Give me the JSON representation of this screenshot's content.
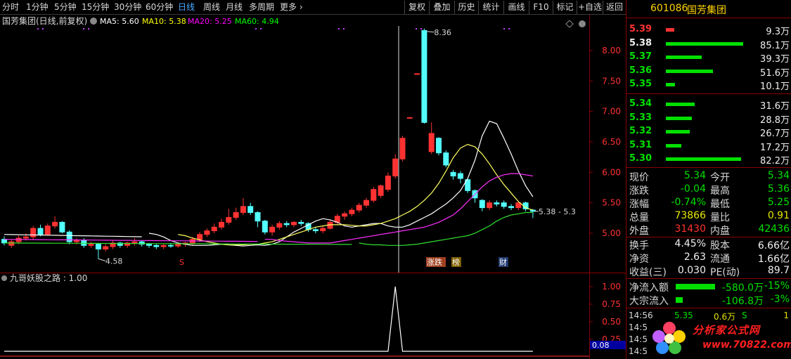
{
  "toolbar": {
    "periods": [
      "分时",
      "1分钟",
      "5分钟",
      "15分钟",
      "30分钟",
      "60分钟",
      "日线",
      "周线",
      "月线",
      "多周期",
      "更多"
    ],
    "active_period": "日线",
    "more_arrow": "›",
    "buttons": [
      "复权",
      "叠加",
      "历史",
      "统计",
      "画线",
      "F10",
      "标记",
      "+自选",
      "返回"
    ]
  },
  "main_chart": {
    "title": "国芳集团(日线,前复权)",
    "ma": [
      {
        "label": "MA5: 5.60",
        "color": "#ffffff"
      },
      {
        "label": "MA10: 5.38",
        "color": "#ffff00"
      },
      {
        "label": "MA20: 5.25",
        "color": "#ff00ff"
      },
      {
        "label": "MA60: 4.94",
        "color": "#00ff00"
      }
    ],
    "price_ticks": [
      "8.00",
      "7.50",
      "7.00",
      "6.50",
      "6.00",
      "5.50",
      "5.00"
    ],
    "high_label": "8.36",
    "low_label": "4.58",
    "last_label": "5.38 - 5.3",
    "markers": [
      {
        "text": "S",
        "color": "#ff3232"
      },
      {
        "text": "涨跌",
        "color": "#ffffff",
        "bg": "#a04020"
      },
      {
        "text": "榜",
        "color": "#ffffff",
        "bg": "#806000"
      },
      {
        "text": "财",
        "color": "#ffffff",
        "bg": "#203a70"
      }
    ]
  },
  "indicator": {
    "title": "九哥妖股之路 : 1.00",
    "ticks": [
      "1.00",
      "0.75",
      "0.50",
      "0.25"
    ],
    "current": "0.08"
  },
  "panel": {
    "code": "601086",
    "name": "国芳集团",
    "asks": [
      {
        "price": "5.39",
        "vol": "9.3万",
        "color": "#ff3232",
        "bar": 0.11,
        "bar_color": "#ff3232"
      },
      {
        "price": "5.38",
        "vol": "85.1万",
        "color": "#f0f0f0",
        "bar": 1.0,
        "bar_color": "#00e000"
      },
      {
        "price": "5.37",
        "vol": "39.3万",
        "color": "#00e000",
        "bar": 0.46,
        "bar_color": "#00e000"
      },
      {
        "price": "5.36",
        "vol": "51.6万",
        "color": "#00e000",
        "bar": 0.61,
        "bar_color": "#00e000"
      },
      {
        "price": "5.35",
        "vol": "10.1万",
        "color": "#00e000",
        "bar": 0.12,
        "bar_color": "#00e000"
      }
    ],
    "bids": [
      {
        "price": "5.34",
        "vol": "31.6万",
        "color": "#00e000",
        "bar": 0.37,
        "bar_color": "#00e000"
      },
      {
        "price": "5.33",
        "vol": "28.8万",
        "color": "#00e000",
        "bar": 0.34,
        "bar_color": "#00e000"
      },
      {
        "price": "5.32",
        "vol": "26.7万",
        "color": "#00e000",
        "bar": 0.31,
        "bar_color": "#00e000"
      },
      {
        "price": "5.31",
        "vol": "17.2万",
        "color": "#00e000",
        "bar": 0.2,
        "bar_color": "#00e000"
      },
      {
        "price": "5.30",
        "vol": "82.2万",
        "color": "#00e000",
        "bar": 0.97,
        "bar_color": "#00e000"
      }
    ],
    "quote": [
      {
        "l1": "现价",
        "v1": "5.34",
        "c1": "#00e000",
        "l2": "今开",
        "v2": "5.34",
        "c2": "#00e000"
      },
      {
        "l1": "涨跌",
        "v1": "-0.04",
        "c1": "#00e000",
        "l2": "最高",
        "v2": "5.36",
        "c2": "#00e000"
      },
      {
        "l1": "涨幅",
        "v1": "-0.74%",
        "c1": "#00e000",
        "l2": "最低",
        "v2": "5.25",
        "c2": "#00e000"
      },
      {
        "l1": "总量",
        "v1": "73866",
        "c1": "#e8e800",
        "l2": "量比",
        "v2": "0.91",
        "c2": "#e8e800"
      },
      {
        "l1": "外盘",
        "v1": "31430",
        "c1": "#ff3232",
        "l2": "内盘",
        "v2": "42436",
        "c2": "#00e000"
      }
    ],
    "quote2": [
      {
        "l1": "换手",
        "v1": "4.45%",
        "c1": "#f0f0f0",
        "l2": "股本",
        "v2": "6.66亿",
        "c2": "#f0f0f0"
      },
      {
        "l1": "净资",
        "v1": "2.63",
        "c1": "#f0f0f0",
        "l2": "流通",
        "v2": "1.66亿",
        "c2": "#f0f0f0"
      },
      {
        "l1": "收益(三)",
        "v1": "0.030",
        "c1": "#f0f0f0",
        "l2": "PE(动)",
        "v2": "89.7",
        "c2": "#f0f0f0"
      }
    ],
    "flows": [
      {
        "label": "净流入额",
        "value": "-580.0万",
        "pct": "-15%",
        "bar": 1.0
      },
      {
        "label": "大宗流入",
        "value": "-106.8万",
        "pct": "-3%",
        "bar": 0.18
      }
    ],
    "ticks": [
      {
        "time": "14:56",
        "price": "5.35",
        "vol": "0.6万",
        "bs": "S",
        "n": "1"
      },
      {
        "time": "14:5",
        "price": "",
        "vol": "",
        "bs": "",
        "n": ""
      },
      {
        "time": "14:5",
        "price": "",
        "vol": "",
        "bs": "",
        "n": ""
      },
      {
        "time": "14:5",
        "price": "",
        "vol": "",
        "bs": "",
        "n": ""
      }
    ],
    "watermark": {
      "name": "分析家公式网",
      "url": "www.70822.com"
    }
  },
  "chart_data": {
    "type": "candlestick",
    "title": "国芳集团(日线,前复权)",
    "ylim": [
      4.45,
      8.6
    ],
    "series": [
      {
        "open": 4.9,
        "close": 4.84,
        "high": 4.95,
        "low": 4.8
      },
      {
        "open": 4.8,
        "close": 4.86,
        "high": 4.9,
        "low": 4.76
      },
      {
        "open": 4.86,
        "close": 4.92,
        "high": 4.96,
        "low": 4.82
      },
      {
        "open": 4.92,
        "close": 4.94,
        "high": 5.0,
        "low": 4.88
      },
      {
        "open": 4.94,
        "close": 5.08,
        "high": 5.12,
        "low": 4.9
      },
      {
        "open": 5.08,
        "close": 4.98,
        "high": 5.14,
        "low": 4.95
      },
      {
        "open": 4.98,
        "close": 5.12,
        "high": 5.16,
        "low": 4.96
      },
      {
        "open": 5.12,
        "close": 5.18,
        "high": 5.28,
        "low": 5.08
      },
      {
        "open": 5.18,
        "close": 5.02,
        "high": 5.2,
        "low": 5.0
      },
      {
        "open": 5.02,
        "close": 4.86,
        "high": 5.05,
        "low": 4.82
      },
      {
        "open": 4.86,
        "close": 4.88,
        "high": 4.92,
        "low": 4.82
      },
      {
        "open": 4.88,
        "close": 4.8,
        "high": 4.92,
        "low": 4.76
      },
      {
        "open": 4.8,
        "close": 4.82,
        "high": 4.86,
        "low": 4.76
      },
      {
        "open": 4.82,
        "close": 4.74,
        "high": 4.84,
        "low": 4.58
      },
      {
        "open": 4.74,
        "close": 4.78,
        "high": 4.82,
        "low": 4.7
      },
      {
        "open": 4.78,
        "close": 4.84,
        "high": 4.88,
        "low": 4.74
      },
      {
        "open": 4.84,
        "close": 4.8,
        "high": 4.86,
        "low": 4.76
      },
      {
        "open": 4.8,
        "close": 4.84,
        "high": 4.86,
        "low": 4.76
      },
      {
        "open": 4.84,
        "close": 4.86,
        "high": 4.92,
        "low": 4.8
      },
      {
        "open": 4.86,
        "close": 4.82,
        "high": 4.88,
        "low": 4.78
      },
      {
        "open": 4.82,
        "close": 4.8,
        "high": 4.84,
        "low": 4.76
      },
      {
        "open": 4.8,
        "close": 4.78,
        "high": 4.82,
        "low": 4.74
      },
      {
        "open": 4.78,
        "close": 4.8,
        "high": 4.82,
        "low": 4.74
      },
      {
        "open": 4.8,
        "close": 4.79,
        "high": 4.84,
        "low": 4.76
      },
      {
        "open": 4.79,
        "close": 4.82,
        "high": 4.84,
        "low": 4.76
      },
      {
        "open": 4.82,
        "close": 4.84,
        "high": 4.86,
        "low": 4.78
      },
      {
        "open": 4.84,
        "close": 4.9,
        "high": 4.94,
        "low": 4.8
      },
      {
        "open": 4.9,
        "close": 4.98,
        "high": 5.02,
        "low": 4.86
      },
      {
        "open": 4.98,
        "close": 5.04,
        "high": 5.08,
        "low": 4.94
      },
      {
        "open": 5.04,
        "close": 5.1,
        "high": 5.16,
        "low": 5.0
      },
      {
        "open": 5.1,
        "close": 5.18,
        "high": 5.24,
        "low": 5.06
      },
      {
        "open": 5.18,
        "close": 5.26,
        "high": 5.4,
        "low": 5.14
      },
      {
        "open": 5.26,
        "close": 5.34,
        "high": 5.42,
        "low": 5.22
      },
      {
        "open": 5.34,
        "close": 5.44,
        "high": 5.58,
        "low": 5.3
      },
      {
        "open": 5.44,
        "close": 5.34,
        "high": 5.5,
        "low": 5.3
      },
      {
        "open": 5.34,
        "close": 5.2,
        "high": 5.36,
        "low": 5.1
      },
      {
        "open": 5.2,
        "close": 5.02,
        "high": 5.22,
        "low": 4.98
      },
      {
        "open": 5.02,
        "close": 5.1,
        "high": 5.14,
        "low": 4.96
      },
      {
        "open": 5.1,
        "close": 5.16,
        "high": 5.2,
        "low": 5.06
      },
      {
        "open": 5.16,
        "close": 5.14,
        "high": 5.2,
        "low": 5.1
      },
      {
        "open": 5.14,
        "close": 5.18,
        "high": 5.2,
        "low": 5.1
      },
      {
        "open": 5.18,
        "close": 5.16,
        "high": 5.22,
        "low": 5.12
      },
      {
        "open": 5.16,
        "close": 5.06,
        "high": 5.18,
        "low": 5.02
      },
      {
        "open": 5.06,
        "close": 5.04,
        "high": 5.1,
        "low": 5.0
      },
      {
        "open": 5.04,
        "close": 5.08,
        "high": 5.12,
        "low": 5.0
      },
      {
        "open": 5.08,
        "close": 5.18,
        "high": 5.22,
        "low": 5.06
      },
      {
        "open": 5.18,
        "close": 5.28,
        "high": 5.32,
        "low": 5.14
      },
      {
        "open": 5.28,
        "close": 5.32,
        "high": 5.36,
        "low": 5.22
      },
      {
        "open": 5.32,
        "close": 5.38,
        "high": 5.42,
        "low": 5.28
      },
      {
        "open": 5.38,
        "close": 5.46,
        "high": 5.5,
        "low": 5.34
      },
      {
        "open": 5.46,
        "close": 5.54,
        "high": 5.58,
        "low": 5.42
      },
      {
        "open": 5.54,
        "close": 5.72,
        "high": 5.76,
        "low": 5.5
      },
      {
        "open": 5.62,
        "close": 5.78,
        "high": 5.8,
        "low": 5.58
      },
      {
        "open": 5.72,
        "close": 5.94,
        "high": 6.0,
        "low": 5.68
      },
      {
        "open": 5.94,
        "close": 6.22,
        "high": 6.3,
        "low": 5.9
      },
      {
        "open": 6.22,
        "close": 6.56,
        "high": 6.6,
        "low": 6.18
      },
      {
        "open": 6.9,
        "close": 6.9,
        "high": 6.91,
        "low": 6.89
      },
      {
        "open": 7.62,
        "close": 7.62,
        "high": 7.63,
        "low": 7.61
      },
      {
        "open": 8.33,
        "close": 6.82,
        "high": 8.36,
        "low": 6.8
      },
      {
        "open": 6.34,
        "close": 6.64,
        "high": 6.82,
        "low": 6.3
      },
      {
        "open": 6.56,
        "close": 6.32,
        "high": 6.58,
        "low": 6.28
      },
      {
        "open": 6.32,
        "close": 6.12,
        "high": 6.36,
        "low": 6.08
      },
      {
        "open": 6.0,
        "close": 5.94,
        "high": 6.04,
        "low": 5.88
      },
      {
        "open": 5.98,
        "close": 5.9,
        "high": 6.02,
        "low": 5.82
      },
      {
        "open": 5.88,
        "close": 5.7,
        "high": 5.9,
        "low": 5.66
      },
      {
        "open": 5.7,
        "close": 5.58,
        "high": 5.72,
        "low": 5.5
      },
      {
        "open": 5.54,
        "close": 5.42,
        "high": 5.56,
        "low": 5.36
      },
      {
        "open": 5.42,
        "close": 5.5,
        "high": 5.54,
        "low": 5.38
      },
      {
        "open": 5.5,
        "close": 5.48,
        "high": 5.54,
        "low": 5.44
      },
      {
        "open": 5.5,
        "close": 5.44,
        "high": 5.54,
        "low": 5.4
      },
      {
        "open": 5.44,
        "close": 5.42,
        "high": 5.48,
        "low": 5.38
      },
      {
        "open": 5.42,
        "close": 5.5,
        "high": 5.52,
        "low": 5.38
      },
      {
        "open": 5.5,
        "close": 5.4,
        "high": 5.52,
        "low": 5.36
      },
      {
        "open": 5.38,
        "close": 5.36,
        "high": 5.4,
        "low": 5.25
      }
    ],
    "ma5": [
      5.0,
      4.98,
      4.94,
      4.88,
      4.84,
      4.82,
      4.8,
      4.8,
      4.8,
      4.81,
      4.82,
      4.81,
      4.8,
      4.79,
      4.8,
      4.81,
      4.8,
      4.82,
      4.86,
      4.94,
      5.02,
      5.08,
      5.14,
      5.2,
      5.24,
      5.22,
      5.18,
      5.12,
      5.1,
      5.12,
      5.14,
      5.16,
      5.16,
      5.12,
      5.1,
      5.1,
      5.14,
      5.2,
      5.26,
      5.32,
      5.4,
      5.48,
      5.58,
      5.7,
      5.9,
      6.2,
      6.6,
      6.84,
      6.8,
      6.56,
      6.3,
      6.02,
      5.78,
      5.6
    ],
    "ma10": [
      4.98,
      4.96,
      4.92,
      4.89,
      4.86,
      4.84,
      4.82,
      4.81,
      4.81,
      4.81,
      4.82,
      4.82,
      4.84,
      4.86,
      4.9,
      4.94,
      4.98,
      5.02,
      5.06,
      5.1,
      5.12,
      5.14,
      5.14,
      5.14,
      5.13,
      5.12,
      5.12,
      5.14,
      5.16,
      5.2,
      5.24,
      5.3,
      5.36,
      5.44,
      5.54,
      5.66,
      5.82,
      6.02,
      6.24,
      6.4,
      6.46,
      6.42,
      6.3,
      6.14,
      5.96,
      5.8,
      5.66,
      5.52,
      5.42,
      5.38
    ],
    "ma20": [
      4.9,
      4.9,
      4.88,
      4.87,
      4.86,
      4.85,
      4.84,
      4.84,
      4.84,
      4.84,
      4.86,
      4.88,
      4.9,
      4.92,
      4.94,
      4.96,
      4.98,
      5.0,
      5.02,
      5.04,
      5.06,
      5.08,
      5.1,
      5.14,
      5.18,
      5.24,
      5.3,
      5.4,
      5.52,
      5.64,
      5.76,
      5.86,
      5.92,
      5.96,
      5.98,
      5.98,
      5.96,
      5.94
    ],
    "ma60": [
      4.84,
      4.82,
      4.81,
      4.81,
      4.8,
      4.8,
      4.8,
      4.81,
      4.82,
      4.84,
      4.86,
      4.88,
      4.9,
      4.92,
      4.94,
      4.96,
      5.0,
      5.06,
      5.12,
      5.2,
      5.26,
      5.3,
      5.32,
      5.34,
      5.34
    ],
    "signal": [
      0,
      0,
      0,
      0,
      0,
      0,
      0,
      0,
      0,
      0,
      0,
      0,
      0,
      0,
      0,
      0,
      0,
      0,
      0,
      0,
      0,
      0,
      0,
      0,
      0,
      0,
      0,
      0,
      0,
      0,
      0,
      0,
      0,
      0,
      0,
      0,
      0,
      0,
      0,
      0,
      0,
      0,
      0,
      0,
      0,
      0,
      0,
      0,
      0,
      0,
      0,
      0,
      0,
      0,
      1.0,
      0,
      0,
      0,
      0,
      0,
      0,
      0,
      0,
      0,
      0,
      0,
      0,
      0,
      0,
      0,
      0,
      0,
      0,
      0
    ],
    "indicator_ylim": [
      0,
      1.1
    ]
  }
}
